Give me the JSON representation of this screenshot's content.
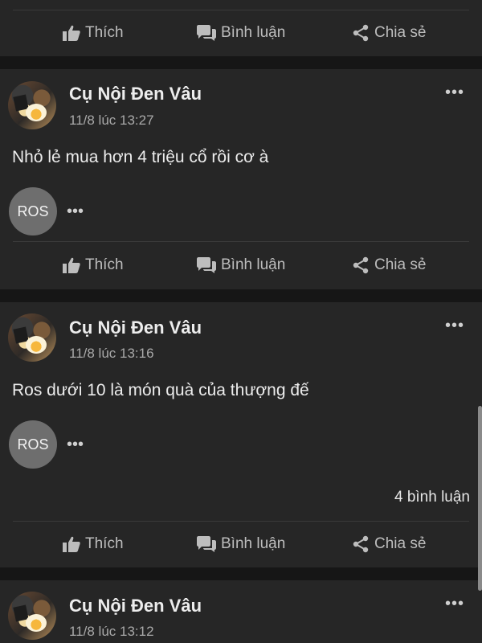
{
  "actions": {
    "like": "Thích",
    "comment": "Bình luận",
    "share": "Chia sẻ"
  },
  "posts": [
    {
      "author": "Cụ Nội Đen Vâu",
      "time": "11/8 lúc 13:27",
      "text": "Nhỏ lẻ mua hơn 4 triệu cổ rồi cơ à",
      "reply_avatar": "ROS",
      "more": "•••",
      "reply_more": "•••"
    },
    {
      "author": "Cụ Nội Đen Vâu",
      "time": "11/8 lúc 13:16",
      "text": "Ros dưới 10 là món quà của thượng đế",
      "reply_avatar": "ROS",
      "more": "•••",
      "reply_more": "•••",
      "comment_count": "4 bình luận"
    },
    {
      "author": "Cụ Nội Đen Vâu",
      "time": "11/8 lúc 13:12",
      "more": "•••"
    }
  ],
  "icons": {
    "like": "thumbs-up-icon",
    "comment": "comment-bubble-icon",
    "share": "share-icon"
  },
  "colors": {
    "background": "#161616",
    "card": "#262626",
    "text": "#e6e6e6",
    "muted": "#a9a9a9"
  }
}
